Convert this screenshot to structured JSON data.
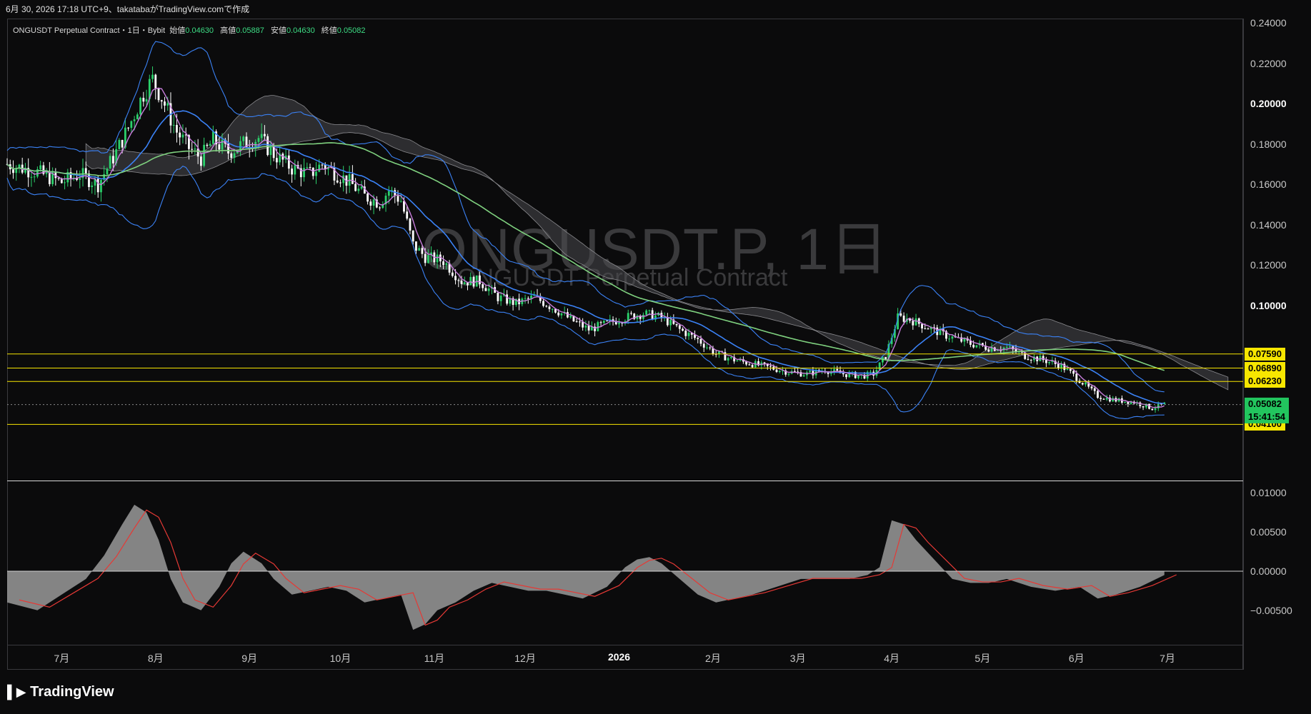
{
  "header": {
    "caption": "6月 30, 2026 17:18 UTC+9、takatabaがTradingView.comで作成"
  },
  "legend": {
    "symbol": "ONGUSDT Perpetual Contract・1日・Bybit",
    "open_label": "始値",
    "open": "0.04630",
    "high_label": "高値",
    "high": "0.05887",
    "low_label": "安値",
    "low": "0.04630",
    "close_label": "終値",
    "close": "0.05082"
  },
  "watermark": {
    "line1": "ONGUSDT.P, 1日",
    "line2": "ONGUSDT Perpetual Contract"
  },
  "brand": {
    "name": "TradingView"
  },
  "colors": {
    "up": "#2bd16b",
    "down": "#ffffff",
    "bb": "#3b82f6",
    "ma_short": "#c77ddb",
    "ma_long": "#7fd17f",
    "cloud": "#4a4a4e",
    "level": "#f7e600",
    "osc": "#9a9a9a",
    "signal": "#e53935"
  },
  "chart_data": [
    {
      "type": "candlestick",
      "title": "ONGUSDT.P, 1日",
      "ylim": [
        0.01,
        0.24
      ],
      "y_ticks": [
        "0.24000",
        "0.22000",
        "0.20000",
        "0.18000",
        "0.16000",
        "0.14000",
        "0.12000",
        "0.10000"
      ],
      "y_tick_values": [
        0.24,
        0.22,
        0.2,
        0.18,
        0.16,
        0.14,
        0.12,
        0.1
      ],
      "x_labels": [
        "7月",
        "8月",
        "9月",
        "10月",
        "11月",
        "12月",
        "2026",
        "2月",
        "3月",
        "4月",
        "5月",
        "6月",
        "7月"
      ],
      "x_label_days": [
        0,
        31,
        62,
        92,
        123,
        153,
        184,
        215,
        243,
        274,
        304,
        335,
        365
      ],
      "x_day_range": [
        -18,
        390
      ],
      "price_path": [
        [
          -18,
          0.17
        ],
        [
          -8,
          0.166
        ],
        [
          0,
          0.161
        ],
        [
          6,
          0.165
        ],
        [
          12,
          0.16
        ],
        [
          18,
          0.176
        ],
        [
          22,
          0.188
        ],
        [
          27,
          0.205
        ],
        [
          30,
          0.212
        ],
        [
          33,
          0.203
        ],
        [
          38,
          0.186
        ],
        [
          42,
          0.178
        ],
        [
          46,
          0.173
        ],
        [
          50,
          0.182
        ],
        [
          55,
          0.176
        ],
        [
          60,
          0.18
        ],
        [
          65,
          0.183
        ],
        [
          70,
          0.175
        ],
        [
          76,
          0.168
        ],
        [
          82,
          0.165
        ],
        [
          86,
          0.17
        ],
        [
          90,
          0.166
        ],
        [
          95,
          0.161
        ],
        [
          100,
          0.154
        ],
        [
          105,
          0.151
        ],
        [
          108,
          0.157
        ],
        [
          112,
          0.152
        ],
        [
          116,
          0.13
        ],
        [
          120,
          0.124
        ],
        [
          126,
          0.122
        ],
        [
          132,
          0.112
        ],
        [
          138,
          0.112
        ],
        [
          144,
          0.104
        ],
        [
          150,
          0.101
        ],
        [
          156,
          0.104
        ],
        [
          162,
          0.099
        ],
        [
          168,
          0.093
        ],
        [
          174,
          0.088
        ],
        [
          180,
          0.091
        ],
        [
          186,
          0.094
        ],
        [
          192,
          0.096
        ],
        [
          198,
          0.094
        ],
        [
          204,
          0.088
        ],
        [
          210,
          0.083
        ],
        [
          216,
          0.076
        ],
        [
          222,
          0.073
        ],
        [
          228,
          0.071
        ],
        [
          234,
          0.069
        ],
        [
          240,
          0.067
        ],
        [
          246,
          0.066
        ],
        [
          252,
          0.068
        ],
        [
          258,
          0.066
        ],
        [
          264,
          0.065
        ],
        [
          268,
          0.066
        ],
        [
          272,
          0.075
        ],
        [
          276,
          0.094
        ],
        [
          280,
          0.093
        ],
        [
          286,
          0.089
        ],
        [
          292,
          0.085
        ],
        [
          300,
          0.081
        ],
        [
          306,
          0.079
        ],
        [
          312,
          0.079
        ],
        [
          318,
          0.075
        ],
        [
          324,
          0.073
        ],
        [
          330,
          0.07
        ],
        [
          336,
          0.063
        ],
        [
          342,
          0.055
        ],
        [
          348,
          0.053
        ],
        [
          354,
          0.052
        ],
        [
          360,
          0.049
        ],
        [
          364,
          0.051
        ]
      ],
      "levels": [
        0.0759,
        0.0689,
        0.0623,
        0.041
      ],
      "level_labels": [
        "0.07590",
        "0.06890",
        "0.06230",
        "0.04100"
      ],
      "current_price": "0.05082",
      "countdown": "15:41:54"
    },
    {
      "type": "area",
      "name": "oscillator",
      "ylim": [
        -0.0095,
        0.0115
      ],
      "y_ticks": [
        "0.01000",
        "0.00500",
        "0.00000",
        "−0.00500"
      ],
      "y_tick_values": [
        0.01,
        0.005,
        0.0,
        -0.005
      ],
      "x": [
        -18,
        -8,
        0,
        8,
        14,
        20,
        24,
        28,
        32,
        36,
        40,
        46,
        52,
        56,
        60,
        66,
        70,
        76,
        82,
        88,
        94,
        100,
        106,
        112,
        116,
        120,
        124,
        130,
        136,
        142,
        148,
        154,
        160,
        166,
        172,
        180,
        186,
        190,
        194,
        198,
        204,
        210,
        216,
        222,
        228,
        236,
        244,
        252,
        260,
        266,
        270,
        274,
        278,
        282,
        288,
        294,
        300,
        306,
        312,
        320,
        328,
        336,
        342,
        348,
        356,
        364
      ],
      "values": [
        -0.004,
        -0.005,
        -0.003,
        -0.001,
        0.002,
        0.006,
        0.0085,
        0.0075,
        0.004,
        -0.001,
        -0.004,
        -0.005,
        -0.002,
        0.001,
        0.0025,
        0.001,
        -0.001,
        -0.003,
        -0.0025,
        -0.002,
        -0.0025,
        -0.004,
        -0.0035,
        -0.003,
        -0.0075,
        -0.0068,
        -0.005,
        -0.004,
        -0.0025,
        -0.0015,
        -0.002,
        -0.0025,
        -0.0025,
        -0.003,
        -0.0035,
        -0.002,
        0.0005,
        0.0015,
        0.0018,
        0.001,
        -0.001,
        -0.003,
        -0.004,
        -0.0035,
        -0.003,
        -0.002,
        -0.001,
        -0.001,
        -0.001,
        -0.0005,
        0.0005,
        0.0065,
        0.006,
        0.004,
        0.0015,
        -0.001,
        -0.0015,
        -0.0015,
        -0.001,
        -0.002,
        -0.0025,
        -0.002,
        -0.0035,
        -0.003,
        -0.002,
        -0.0005
      ],
      "signal_lag": 4
    }
  ]
}
